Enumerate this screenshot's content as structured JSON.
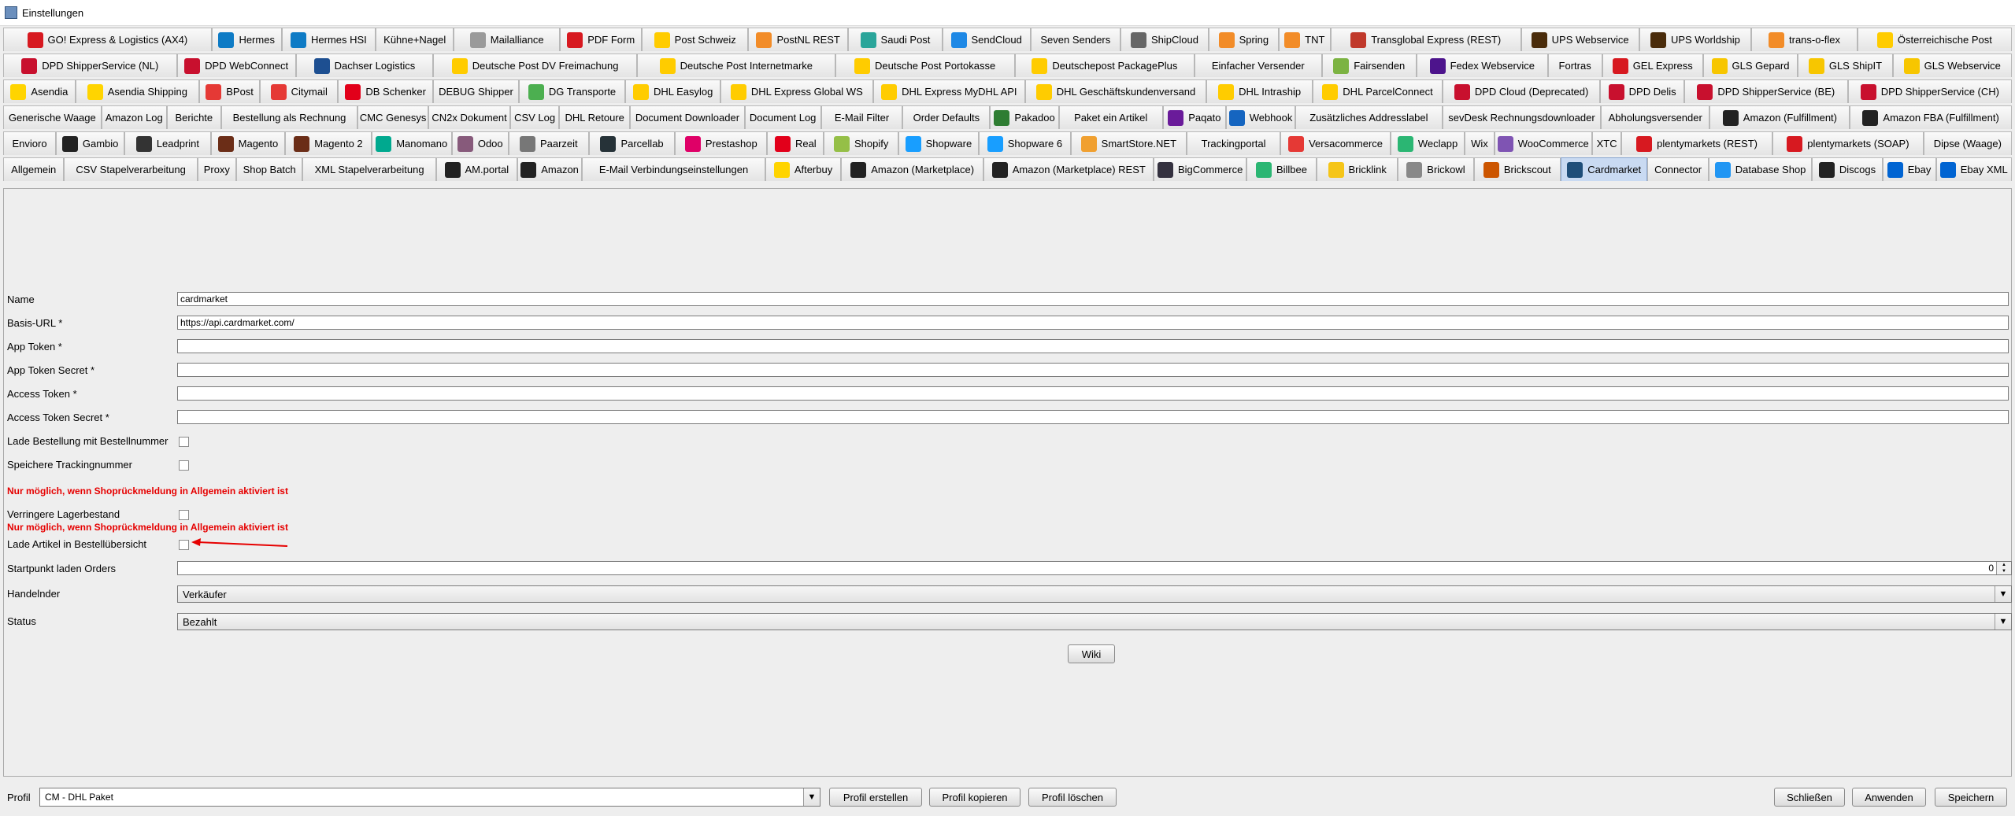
{
  "window": {
    "title": "Einstellungen"
  },
  "tabs": {
    "rows": [
      [
        {
          "label": "GO! Express & Logistics (AX4)",
          "icon": "go-logo-icon",
          "color": "#d71920"
        },
        {
          "label": "Hermes",
          "icon": "hermes-icon",
          "color": "#0e7bc5"
        },
        {
          "label": "Hermes HSI",
          "icon": "hermes-icon",
          "color": "#0e7bc5"
        },
        {
          "label": "Kühne+Nagel",
          "icon": "",
          "color": ""
        },
        {
          "label": "Mailalliance",
          "icon": "mail-icon",
          "color": "#9a9a9a"
        },
        {
          "label": "PDF Form",
          "icon": "pdf-icon",
          "color": "#d71920"
        },
        {
          "label": "Post Schweiz",
          "icon": "post-horn-icon",
          "color": "#ffcc00"
        },
        {
          "label": "PostNL REST",
          "icon": "postnl-icon",
          "color": "#f28c28"
        },
        {
          "label": "Saudi Post",
          "icon": "saudi-post-icon",
          "color": "#2aa59a"
        },
        {
          "label": "SendCloud",
          "icon": "cloud-icon",
          "color": "#1e88e5"
        },
        {
          "label": "Seven Senders",
          "icon": "",
          "color": ""
        },
        {
          "label": "ShipCloud",
          "icon": "shipcloud-icon",
          "color": "#666666"
        },
        {
          "label": "Spring",
          "icon": "spring-icon",
          "color": "#f28c28"
        },
        {
          "label": "TNT",
          "icon": "tnt-icon",
          "color": "#f28c28"
        },
        {
          "label": "Transglobal Express (REST)",
          "icon": "globe-icon",
          "color": "#c0392b"
        },
        {
          "label": "UPS Webservice",
          "icon": "ups-icon",
          "color": "#4a2c0b"
        },
        {
          "label": "UPS Worldship",
          "icon": "ups-icon",
          "color": "#4a2c0b"
        },
        {
          "label": "trans-o-flex",
          "icon": "trans-o-flex-icon",
          "color": "#f28c28"
        },
        {
          "label": "Österreichische Post",
          "icon": "post-horn-icon",
          "color": "#ffcc00"
        }
      ],
      [
        {
          "label": "DPD ShipperService (NL)",
          "icon": "dpd-cube-icon",
          "color": "#c8102e"
        },
        {
          "label": "DPD WebConnect",
          "icon": "dpd-cube-icon",
          "color": "#c8102e"
        },
        {
          "label": "Dachser Logistics",
          "icon": "dachser-icon",
          "color": "#1d4f91"
        },
        {
          "label": "Deutsche Post DV Freimachung",
          "icon": "post-horn-icon",
          "color": "#ffcc00"
        },
        {
          "label": "Deutsche Post Internetmarke",
          "icon": "post-horn-icon",
          "color": "#ffcc00"
        },
        {
          "label": "Deutsche Post Portokasse",
          "icon": "post-horn-icon",
          "color": "#ffcc00"
        },
        {
          "label": "Deutschepost PackagePlus",
          "icon": "post-horn-icon",
          "color": "#ffcc00"
        },
        {
          "label": "Einfacher Versender",
          "icon": "",
          "color": ""
        },
        {
          "label": "Fairsenden",
          "icon": "fairsenden-icon",
          "color": "#7cb342"
        },
        {
          "label": "Fedex Webservice",
          "icon": "fedex-icon",
          "color": "#4d148c"
        },
        {
          "label": "Fortras",
          "icon": "",
          "color": ""
        },
        {
          "label": "GEL Express",
          "icon": "gel-icon",
          "color": "#d71920"
        },
        {
          "label": "GLS Gepard",
          "icon": "gls-icon",
          "color": "#f7c600"
        },
        {
          "label": "GLS ShipIT",
          "icon": "gls-icon",
          "color": "#f7c600"
        },
        {
          "label": "GLS Webservice",
          "icon": "gls-icon",
          "color": "#f7c600"
        }
      ],
      [
        {
          "label": "Asendia",
          "icon": "asendia-icon",
          "color": "#ffd400"
        },
        {
          "label": "Asendia Shipping",
          "icon": "asendia-icon",
          "color": "#ffd400"
        },
        {
          "label": "BPost",
          "icon": "bpost-icon",
          "color": "#e53935"
        },
        {
          "label": "Citymail",
          "icon": "citymail-icon",
          "color": "#e53935"
        },
        {
          "label": "DB Schenker",
          "icon": "db-icon",
          "color": "#e2001a"
        },
        {
          "label": "DEBUG Shipper",
          "icon": "",
          "color": ""
        },
        {
          "label": "DG Transporte",
          "icon": "dg-icon",
          "color": "#4caf50"
        },
        {
          "label": "DHL Easylog",
          "icon": "dhl-icon",
          "color": "#ffcc00"
        },
        {
          "label": "DHL Express Global WS",
          "icon": "dhl-icon",
          "color": "#ffcc00"
        },
        {
          "label": "DHL Express MyDHL API",
          "icon": "dhl-icon",
          "color": "#ffcc00"
        },
        {
          "label": "DHL Geschäftskundenversand",
          "icon": "dhl-icon",
          "color": "#ffcc00"
        },
        {
          "label": "DHL Intraship",
          "icon": "dhl-icon",
          "color": "#ffcc00"
        },
        {
          "label": "DHL ParcelConnect",
          "icon": "dhl-icon",
          "color": "#ffcc00"
        },
        {
          "label": "DPD Cloud (Deprecated)",
          "icon": "dpd-cube-icon",
          "color": "#c8102e"
        },
        {
          "label": "DPD Delis",
          "icon": "dpd-cube-icon",
          "color": "#c8102e"
        },
        {
          "label": "DPD ShipperService (BE)",
          "icon": "dpd-cube-icon",
          "color": "#c8102e"
        },
        {
          "label": "DPD ShipperService (CH)",
          "icon": "dpd-cube-icon",
          "color": "#c8102e"
        }
      ],
      [
        {
          "label": "Generische Waage",
          "icon": "",
          "color": ""
        },
        {
          "label": "Amazon Log",
          "icon": "",
          "color": ""
        },
        {
          "label": "Berichte",
          "icon": "",
          "color": ""
        },
        {
          "label": "Bestellung als Rechnung",
          "icon": "",
          "color": ""
        },
        {
          "label": "CMC Genesys",
          "icon": "",
          "color": ""
        },
        {
          "label": "CN2x Dokument",
          "icon": "",
          "color": ""
        },
        {
          "label": "CSV Log",
          "icon": "",
          "color": ""
        },
        {
          "label": "DHL Retoure",
          "icon": "",
          "color": ""
        },
        {
          "label": "Document Downloader",
          "icon": "",
          "color": ""
        },
        {
          "label": "Document Log",
          "icon": "",
          "color": ""
        },
        {
          "label": "E-Mail Filter",
          "icon": "",
          "color": ""
        },
        {
          "label": "Order Defaults",
          "icon": "",
          "color": ""
        },
        {
          "label": "Pakadoo",
          "icon": "pakadoo-icon",
          "color": "#2e7d32"
        },
        {
          "label": "Paket ein Artikel",
          "icon": "",
          "color": ""
        },
        {
          "label": "Paqato",
          "icon": "paqato-icon",
          "color": "#6a1b9a"
        },
        {
          "label": "Webhook",
          "icon": "webhook-icon",
          "color": "#1565c0"
        },
        {
          "label": "Zusätzliches Addresslabel",
          "icon": "",
          "color": ""
        },
        {
          "label": "sevDesk Rechnungsdownloader",
          "icon": "",
          "color": ""
        },
        {
          "label": "Abholungsversender",
          "icon": "",
          "color": ""
        },
        {
          "label": "Amazon (Fulfillment)",
          "icon": "amazon-icon",
          "color": "#222222"
        },
        {
          "label": "Amazon FBA (Fulfillment)",
          "icon": "amazon-icon",
          "color": "#222222"
        }
      ],
      [
        {
          "label": "Envioro",
          "icon": "",
          "color": ""
        },
        {
          "label": "Gambio",
          "icon": "gambio-icon",
          "color": "#222222"
        },
        {
          "label": "Leadprint",
          "icon": "leadprint-icon",
          "color": "#333333"
        },
        {
          "label": "Magento",
          "icon": "magento-icon",
          "color": "#6b2d17"
        },
        {
          "label": "Magento 2",
          "icon": "magento-icon",
          "color": "#6b2d17"
        },
        {
          "label": "Manomano",
          "icon": "manomano-icon",
          "color": "#00a98f"
        },
        {
          "label": "Odoo",
          "icon": "odoo-icon",
          "color": "#875a7b"
        },
        {
          "label": "Paarzeit",
          "icon": "paarzeit-icon",
          "color": "#777777"
        },
        {
          "label": "Parcellab",
          "icon": "parcellab-icon",
          "color": "#263238"
        },
        {
          "label": "Prestashop",
          "icon": "prestashop-icon",
          "color": "#df0067"
        },
        {
          "label": "Real",
          "icon": "real-icon",
          "color": "#e2001a"
        },
        {
          "label": "Shopify",
          "icon": "shopify-icon",
          "color": "#95bf47"
        },
        {
          "label": "Shopware",
          "icon": "shopware-icon",
          "color": "#189eff"
        },
        {
          "label": "Shopware 6",
          "icon": "shopware-icon",
          "color": "#189eff"
        },
        {
          "label": "SmartStore.NET",
          "icon": "smartstore-icon",
          "color": "#f0a030"
        },
        {
          "label": "Trackingportal",
          "icon": "",
          "color": ""
        },
        {
          "label": "Versacommerce",
          "icon": "versacommerce-icon",
          "color": "#e53935"
        },
        {
          "label": "Weclapp",
          "icon": "weclapp-icon",
          "color": "#2bb673"
        },
        {
          "label": "Wix",
          "icon": "",
          "color": ""
        },
        {
          "label": "WooCommerce",
          "icon": "woocommerce-icon",
          "color": "#7f54b3"
        },
        {
          "label": "XTC",
          "icon": "",
          "color": ""
        },
        {
          "label": "plentymarkets (REST)",
          "icon": "plentymarkets-icon",
          "color": "#d71920"
        },
        {
          "label": "plentymarkets (SOAP)",
          "icon": "plentymarkets-icon",
          "color": "#d71920"
        },
        {
          "label": "Dipse (Waage)",
          "icon": "",
          "color": ""
        }
      ],
      [
        {
          "label": "Allgemein",
          "icon": "",
          "color": ""
        },
        {
          "label": "CSV Stapelverarbeitung",
          "icon": "",
          "color": ""
        },
        {
          "label": "Proxy",
          "icon": "",
          "color": ""
        },
        {
          "label": "Shop Batch",
          "icon": "",
          "color": ""
        },
        {
          "label": "XML Stapelverarbeitung",
          "icon": "",
          "color": ""
        },
        {
          "label": "AM.portal",
          "icon": "amazon-icon",
          "color": "#222222"
        },
        {
          "label": "Amazon",
          "icon": "amazon-icon",
          "color": "#222222"
        },
        {
          "label": "E-Mail Verbindungseinstellungen",
          "icon": "",
          "color": ""
        },
        {
          "label": "Afterbuy",
          "icon": "afterbuy-icon",
          "color": "#ffd400"
        },
        {
          "label": "Amazon (Marketplace)",
          "icon": "amazon-icon",
          "color": "#222222"
        },
        {
          "label": "Amazon (Marketplace) REST",
          "icon": "amazon-icon",
          "color": "#222222"
        },
        {
          "label": "BigCommerce",
          "icon": "bigcommerce-icon",
          "color": "#34313f"
        },
        {
          "label": "Billbee",
          "icon": "billbee-icon",
          "color": "#2bb673"
        },
        {
          "label": "Bricklink",
          "icon": "bricklink-icon",
          "color": "#f5c518"
        },
        {
          "label": "Brickowl",
          "icon": "brickowl-icon",
          "color": "#888888"
        },
        {
          "label": "Brickscout",
          "icon": "brickscout-icon",
          "color": "#cc5500"
        },
        {
          "label": "Cardmarket",
          "icon": "cardmarket-icon",
          "color": "#1f4e79",
          "selected": true
        },
        {
          "label": "Connector",
          "icon": "",
          "color": ""
        },
        {
          "label": "Database Shop",
          "icon": "database-icon",
          "color": "#2196f3"
        },
        {
          "label": "Discogs",
          "icon": "discogs-icon",
          "color": "#222222"
        },
        {
          "label": "Ebay",
          "icon": "ebay-icon",
          "color": "#0064d2"
        },
        {
          "label": "Ebay XML",
          "icon": "ebay-icon",
          "color": "#0064d2"
        }
      ]
    ]
  },
  "form": {
    "name_label": "Name",
    "name_value": "cardmarket",
    "base_url_label": "Basis-URL *",
    "base_url_value": "https://api.cardmarket.com/",
    "app_token_label": "App Token *",
    "app_token_value": "",
    "app_token_secret_label": "App Token Secret *",
    "app_token_secret_value": "",
    "access_token_label": "Access Token *",
    "access_token_value": "",
    "access_token_secret_label": "Access Token Secret *",
    "access_token_secret_value": "",
    "load_order_label": "Lade Bestellung mit Bestellnummer",
    "save_tracking_label": "Speichere Trackingnummer",
    "warning_1": "Nur möglich, wenn Shoprückmeldung in Allgemein aktiviert ist",
    "reduce_stock_label": "Verringere Lagerbestand",
    "warning_2": "Nur möglich, wenn Shoprückmeldung in Allgemein aktiviert ist",
    "load_articles_label": "Lade Artikel in Bestellübersicht",
    "startpoint_label": "Startpunkt laden Orders",
    "startpoint_value": "0",
    "trader_label": "Handelnder",
    "trader_value": "Verkäufer",
    "status_label": "Status",
    "status_value": "Bezahlt",
    "wiki_button": "Wiki",
    "annotation_color": "#e60000"
  },
  "footer": {
    "profile_label": "Profil",
    "profile_value": "CM - DHL Paket",
    "create_profile": "Profil erstellen",
    "copy_profile": "Profil kopieren",
    "delete_profile": "Profil löschen",
    "close": "Schließen",
    "apply": "Anwenden",
    "save": "Speichern"
  }
}
